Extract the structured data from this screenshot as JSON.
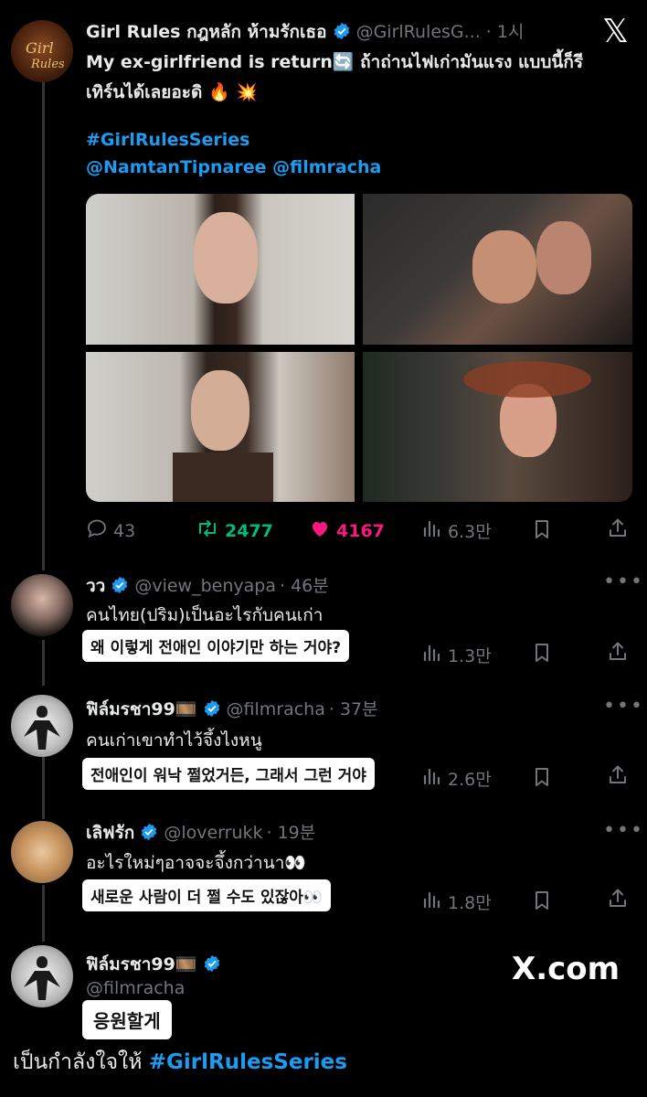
{
  "brand": {
    "x_logo": "𝕏",
    "watermark": "X.com"
  },
  "main_post": {
    "author": "Girl Rules กฎหลัก ห้ามรักเธอ",
    "handle": "@GirlRulesG...",
    "time": "· 1시",
    "line1": "My ex-girlfriend is return🔄 ถ้าถ่านไฟเก่ามันแรง แบบนี้ก็รี",
    "line2": "เทิร์นได้เลยอะดิ 🔥 💥",
    "hashtag": "#GirlRulesSeries",
    "mentions": "@NamtanTipnaree @filmracha",
    "replies": "43",
    "reposts": "2477",
    "likes": "4167",
    "views": "6.3만"
  },
  "replies": [
    {
      "name": "วว",
      "handle": "@view_benyapa",
      "time": "· 46분",
      "text": "คนไทย(ปริม)เป็นอะไรกับคนเก่า",
      "caption": "왜 이렇게 전애인 이야기만 하는 거야?",
      "views": "1.3만"
    },
    {
      "name": "ฟิล์มรชา99🎞️",
      "handle": "@filmracha",
      "time": "· 37분",
      "text": "คนเก่าเขาทำไว้จึ้งไงหนู",
      "caption": "전애인이 워낙 쩔었거든, 그래서 그런 거야",
      "views": "2.6만"
    },
    {
      "name": "เลิฟรัก",
      "handle": "@loverrukk",
      "time": "· 19분",
      "text": "อะไรใหม่ๆอาจจะจึ้งกว่านา👀",
      "caption": "새로운 사람이 더 쩔 수도 있잖아👀",
      "views": "1.8만"
    }
  ],
  "last_post": {
    "name": "ฟิล์มรชา99🎞️",
    "handle": "@filmracha",
    "caption": "응원할게",
    "text_prefix": "เป็นกำลังใจให้ ",
    "hashtag": "#GirlRulesSeries"
  },
  "icons": [
    "reply-icon",
    "repost-icon",
    "like-icon",
    "views-icon",
    "bookmark-icon",
    "share-icon",
    "verified-icon",
    "more-icon"
  ],
  "colors": {
    "background": "#000000",
    "accent": "#1d9bf0",
    "repost": "#00ba7c",
    "like": "#f91880",
    "muted": "#71767b"
  }
}
